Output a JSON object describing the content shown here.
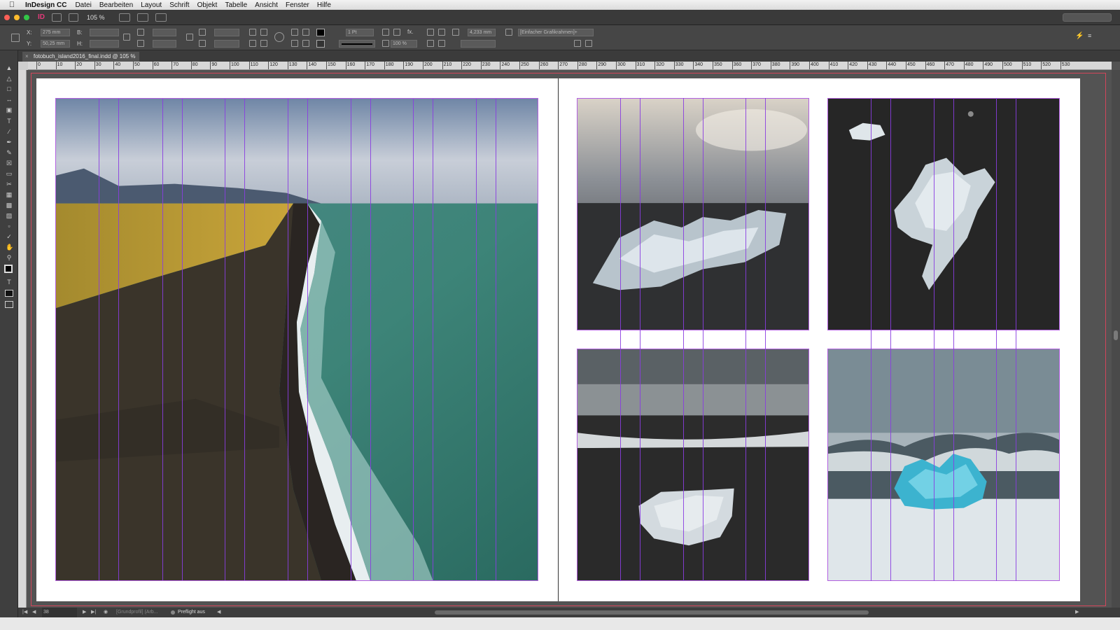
{
  "menubar": {
    "app_name": "InDesign CC",
    "items": [
      "Datei",
      "Bearbeiten",
      "Layout",
      "Schrift",
      "Objekt",
      "Tabelle",
      "Ansicht",
      "Fenster",
      "Hilfe"
    ]
  },
  "titlebar": {
    "app_logo": "ID",
    "zoom": "105 %"
  },
  "controlbar": {
    "x_label": "X:",
    "y_label": "Y:",
    "x_value": "275 mm",
    "y_value": "50,25 mm",
    "w_label": "B:",
    "h_label": "H:",
    "stroke_weight": "1 Pt",
    "offset": "4,233 mm",
    "opacity": "100 %",
    "object_style": "[Einfacher Grafikrahmen]+"
  },
  "tab": {
    "close_glyph": "×",
    "title": "fotobuch_island2016_final.indd @ 105 %"
  },
  "ruler": {
    "ticks": [
      "0",
      "10",
      "20",
      "30",
      "40",
      "50",
      "60",
      "70",
      "80",
      "90",
      "100",
      "110",
      "120",
      "130",
      "140",
      "150",
      "160",
      "170",
      "180",
      "190",
      "200",
      "210",
      "220",
      "230",
      "240",
      "250",
      "260",
      "270",
      "280",
      "290",
      "300",
      "310",
      "320",
      "330",
      "340",
      "350",
      "360",
      "370",
      "380",
      "390",
      "400",
      "410",
      "420",
      "430",
      "440",
      "450",
      "460",
      "470",
      "480",
      "490",
      "500",
      "510",
      "520",
      "530"
    ]
  },
  "statusbar": {
    "page_number": "38",
    "profile": "[Grundprofil] (Arb...",
    "preflight": "Preflight aus"
  },
  "colors": {
    "guide": "#8a3de0",
    "frame": "#b25fe0",
    "bleed": "#d2465a",
    "pasteboard": "#535353"
  },
  "images": [
    {
      "name": "aerial-black-sand-beach-coastline",
      "icon": "photo"
    },
    {
      "name": "ice-chunk-on-black-beach-sunlit",
      "icon": "photo"
    },
    {
      "name": "ice-chunk-on-black-sand-top-view",
      "icon": "photo"
    },
    {
      "name": "ice-chunk-on-black-sand-grey-surf",
      "icon": "photo"
    },
    {
      "name": "blue-ice-in-waves",
      "icon": "photo"
    }
  ]
}
